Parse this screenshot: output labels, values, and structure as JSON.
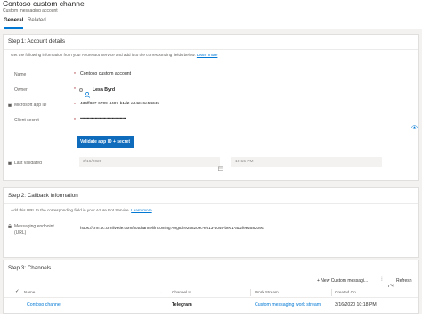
{
  "header": {
    "title": "Contoso custom channel",
    "subtitle": "Custom messaging account",
    "tabs": [
      "General",
      "Related"
    ]
  },
  "step1": {
    "title": "Step 1: Account details",
    "description": "Get the following information from your Azure Bot Service and add it to the corresponding fields below.",
    "learn_more": "Learn more",
    "name_label": "Name",
    "name_value": "Contoso custom account",
    "owner_label": "Owner",
    "owner_value": "Lesa Byrd",
    "app_id_label": "Microsoft app ID",
    "app_id_value": "436ff837-6709-4407-b1d2-a04246e54345",
    "secret_label": "Client secret",
    "secret_value": "••••••••••••••••••••••••••••••••••••••••",
    "validate_button": "Validate app ID + secret",
    "last_validated_label": "Last validated",
    "last_validated_date": "3/16/2020",
    "last_validated_time": "10:15 PM"
  },
  "step2": {
    "title": "Step 2: Callback information",
    "description": "Add this URL to the corresponding field in your Azure Bot Service.",
    "learn_more": "Learn more",
    "endpoint_label_1": "Messaging endpoint",
    "endpoint_label_2": "(URL)",
    "endpoint_value": "https://crm.oc.crmlivetie.com/botchannel/incoming?orgId=e258209c-eb13-404e-be01-aa2fee258209c"
  },
  "step3": {
    "title": "Step 3: Channels",
    "new_button": "+ New Custom messagi...",
    "refresh_button": "Refresh",
    "columns": [
      "Name",
      "Channel Id",
      "Work Stream",
      "Created On"
    ],
    "rows": [
      {
        "name": "Contoso channel",
        "channel_id": "Telegram",
        "work_stream": "Custom messaging work stream",
        "created_on": "3/16/2020 10:18 PM"
      }
    ]
  },
  "colors": {
    "accent": "#0078d4",
    "button": "#0f6cbd",
    "required": "#a4262c"
  }
}
